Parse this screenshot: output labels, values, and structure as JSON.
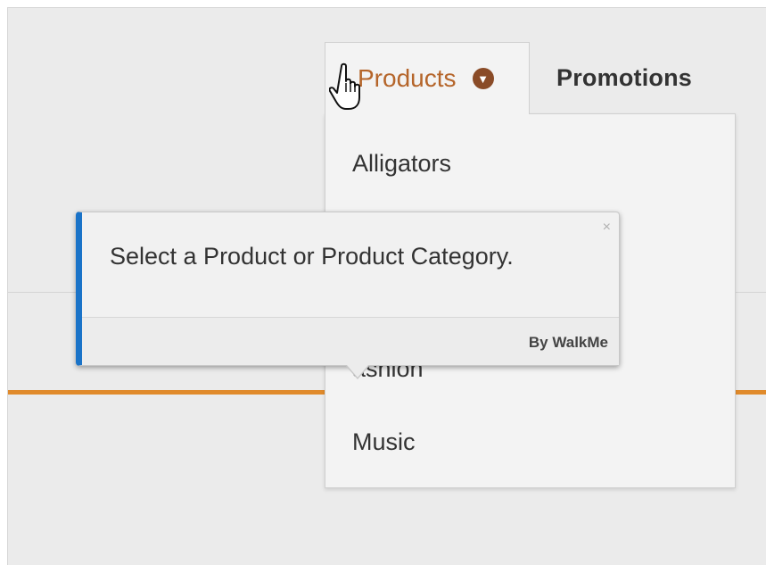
{
  "nav": {
    "tabs": [
      {
        "label": "Products",
        "active": true,
        "icon": "chevron-down-icon"
      },
      {
        "label": "Promotions",
        "active": false
      }
    ]
  },
  "dropdown": {
    "items": [
      {
        "label": "Alligators"
      },
      {
        "label": "ashion"
      },
      {
        "label": "Music"
      }
    ]
  },
  "popup": {
    "message": "Select a Product or Product Category.",
    "close_icon": "×",
    "credit": "By WalkMe",
    "accent_color": "#1a73c8"
  },
  "colors": {
    "active_tab_text": "#b5652a",
    "orange_bar": "#e08a2b",
    "chevron_badge": "#8a4b27"
  }
}
